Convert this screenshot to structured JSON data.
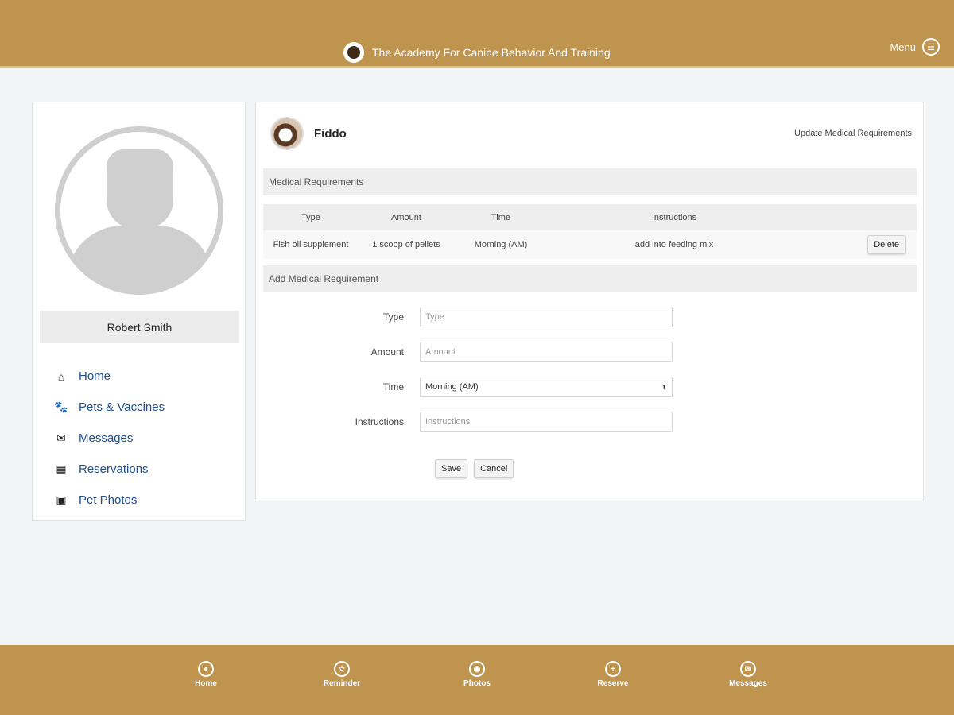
{
  "header": {
    "title": "The Academy For Canine Behavior And Training",
    "menu_label": "Menu"
  },
  "sidebar": {
    "user_name": "Robert Smith",
    "items": [
      {
        "label": "Home",
        "icon": "home-icon"
      },
      {
        "label": "Pets & Vaccines",
        "icon": "paw-icon"
      },
      {
        "label": "Messages",
        "icon": "envelope-icon"
      },
      {
        "label": "Reservations",
        "icon": "calendar-icon"
      },
      {
        "label": "Pet Photos",
        "icon": "image-icon"
      }
    ]
  },
  "main": {
    "pet_name": "Fiddo",
    "update_link": "Update Medical Requirements",
    "section_title": "Medical Requirements",
    "table": {
      "headers": [
        "Type",
        "Amount",
        "Time",
        "Instructions"
      ],
      "rows": [
        {
          "type": "Fish oil supplement",
          "amount": "1 scoop of pellets",
          "time": "Morning (AM)",
          "instructions": "add into feeding mix",
          "action": "Delete"
        }
      ]
    },
    "add_title": "Add Medical Requirement",
    "form": {
      "type": {
        "label": "Type",
        "placeholder": "Type",
        "value": ""
      },
      "amount": {
        "label": "Amount",
        "placeholder": "Amount",
        "value": ""
      },
      "time": {
        "label": "Time",
        "value": "Morning (AM)"
      },
      "instructions": {
        "label": "Instructions",
        "placeholder": "Instructions",
        "value": ""
      }
    },
    "save_label": "Save",
    "cancel_label": "Cancel"
  },
  "bottom_nav": [
    {
      "label": "Home"
    },
    {
      "label": "Reminder"
    },
    {
      "label": "Photos"
    },
    {
      "label": "Reserve"
    },
    {
      "label": "Messages"
    }
  ],
  "colors": {
    "brand": "#bf944f",
    "link": "#1e4e8c"
  }
}
